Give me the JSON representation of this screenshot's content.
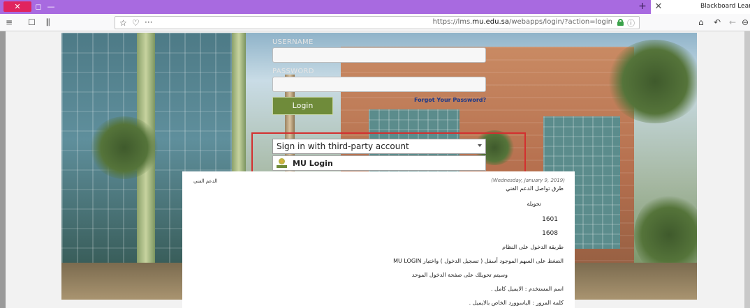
{
  "window": {
    "close_glyph": "✕",
    "tab_glyph": "◻",
    "minimize_glyph": "—",
    "newtab_glyph": "+",
    "tabclose_glyph": "✕",
    "tab_title": "Blackboard Learn"
  },
  "toolbar": {
    "menu_glyph": "≡",
    "reader_glyph": "☐",
    "library_glyph": "⫼",
    "bookmark_glyph": "☆",
    "pocket_glyph": "♡",
    "more_glyph": "···",
    "url_prefix": "https://lms.",
    "url_domain": "mu.edu.sa",
    "url_path": "/webapps/login/?action=login",
    "permissions_glyph": "ⓘ",
    "home_glyph": "⌂",
    "undo_glyph": "↶",
    "back_glyph": "←",
    "zoom_glyph": "⊖"
  },
  "login": {
    "username_label": "USERNAME",
    "username_value": "",
    "password_label": "PASSWORD",
    "password_value": "",
    "login_button": "Login",
    "forgot_link": "Forgot Your Password?",
    "third_party_select": "Sign in with third-party account",
    "third_party_option": "MU Login"
  },
  "announcement": {
    "header": "الدعم الفني",
    "date": "(Wednesday, January 9, 2019)",
    "lines": [
      "طرق تواصل الدعم الفني",
      "تحويلة",
      "1601",
      "1608",
      "طريقة الدخول على النظام",
      "الضغط على السهم الموجود أسفل ( تسجيل الدخول ) واختيار  MU LOGIN",
      "وسيتم تحويلك على صفحة  الدخول الموحد",
      "اسم المستخدم : الايميل كامل .",
      "كلمة المرور : الباسوورد الخاص بالايميل ."
    ]
  },
  "colors": {
    "titlebar": "#a86ae0",
    "login_button": "#6f8b3a",
    "highlight_box": "#d32f2f",
    "forgot_link": "#1d3a8a"
  }
}
